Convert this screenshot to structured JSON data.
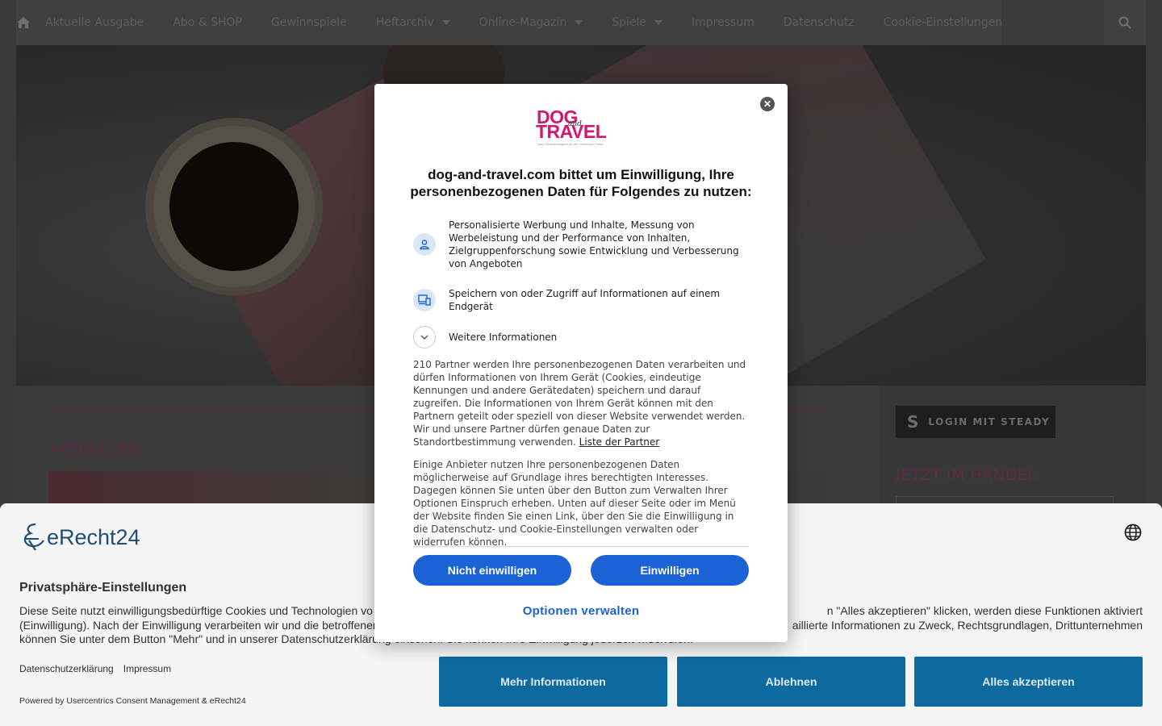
{
  "site": {
    "nav": {
      "home_icon": "home-icon",
      "items": [
        {
          "label": "Aktuelle Ausgabe",
          "has_dropdown": false
        },
        {
          "label": "Abo & SHOP",
          "has_dropdown": false
        },
        {
          "label": "Gewinnspiele",
          "has_dropdown": false
        },
        {
          "label": "Heftarchiv",
          "has_dropdown": true
        },
        {
          "label": "Online-Magazin",
          "has_dropdown": true
        },
        {
          "label": "Spiele",
          "has_dropdown": true
        },
        {
          "label": "Impressum",
          "has_dropdown": false
        },
        {
          "label": "Datenschutz",
          "has_dropdown": false
        },
        {
          "label": "Cookie-Einstellungen",
          "has_dropdown": false
        }
      ],
      "search_icon": "search-icon"
    },
    "main": {
      "section_title": "AKTUELLES"
    },
    "sidebar": {
      "steady_label": "LOGIN MIT STEADY",
      "section_title": "JETZT IM HANDEL:"
    }
  },
  "consent_dialog": {
    "brand": {
      "line1": "DOG",
      "connector": "and",
      "line2": "TRAVEL",
      "tagline": "Das Lifestylemagazin für den modernen Hund"
    },
    "title": "dog-and-travel.com bittet um Einwilligung, Ihre personenbezogenen Daten für Folgendes zu nutzen:",
    "purposes": [
      {
        "icon": "person-icon",
        "text": "Personalisierte Werbung und Inhalte, Messung von Werbeleistung und der Performance von Inhalten, Zielgruppenforschung sowie Entwicklung und Verbesserung von Angeboten"
      },
      {
        "icon": "devices-icon",
        "text": "Speichern von oder Zugriff auf Informationen auf einem Endgerät"
      },
      {
        "icon": "chevron-down-icon",
        "text": "Weitere Informationen"
      }
    ],
    "paragraph1": "210 Partner werden Ihre personenbezogenen Daten verarbeiten und dürfen Informationen von Ihrem Gerät (Cookies, eindeutige Kennungen und andere Gerätedaten) speichern und darauf zugreifen. Die Informationen von Ihrem Gerät können mit den Partnern geteilt oder speziell von dieser Website verwendet werden. Wir und unsere Partner dürfen genaue Daten zur Standortbestimmung verwenden.",
    "partner_link": "Liste der Partner",
    "paragraph2": "Einige Anbieter nutzen Ihre personenbezogenen Daten möglicherweise auf Grundlage ihres berechtigten Interesses. Dagegen können Sie unten über den Button zum Verwalten Ihrer Optionen Einspruch erheben. Unten auf dieser Seite oder im Menü der Website finden Sie einen Link, über den Sie die Einwilligung in die Datenschutz- und Cookie-Einstellungen verwalten oder widerrufen können.",
    "decline_label": "Nicht einwilligen",
    "accept_label": "Einwilligen",
    "options_label": "Optionen verwalten",
    "accent_color": "#1a62d6"
  },
  "cookie_banner": {
    "logo_text": "eRecht24",
    "title": "Privatsphäre-Einstellungen",
    "line1_left": "Diese Seite nutzt einwilligungsbedürftige Cookies und Technologien vo",
    "line1_right": "n \"Alles akzeptieren\" klicken, werden diese Funktionen aktiviert",
    "line2_left": "(Einwilligung). Nach der Einwilligung verarbeiten wir und die betroffenen",
    "line2_right": "aillierte Informationen zu Zweck, Rechtsgrundlagen, Drittunternehmen",
    "line3": "können Sie unter dem Button \"Mehr\" und in unserer Datenschutzerklärung einsehen. Sie können Ihre Einwilligung jederzeit widerrufen.",
    "links": [
      "Datenschutzerklärung",
      "Impressum"
    ],
    "powered_by": "Powered by Usercentrics Consent Management & eRecht24",
    "buttons": {
      "more": "Mehr Informationen",
      "decline": "Ablehnen",
      "accept_all": "Alles akzeptieren"
    },
    "button_color": "#0d6aa0"
  }
}
